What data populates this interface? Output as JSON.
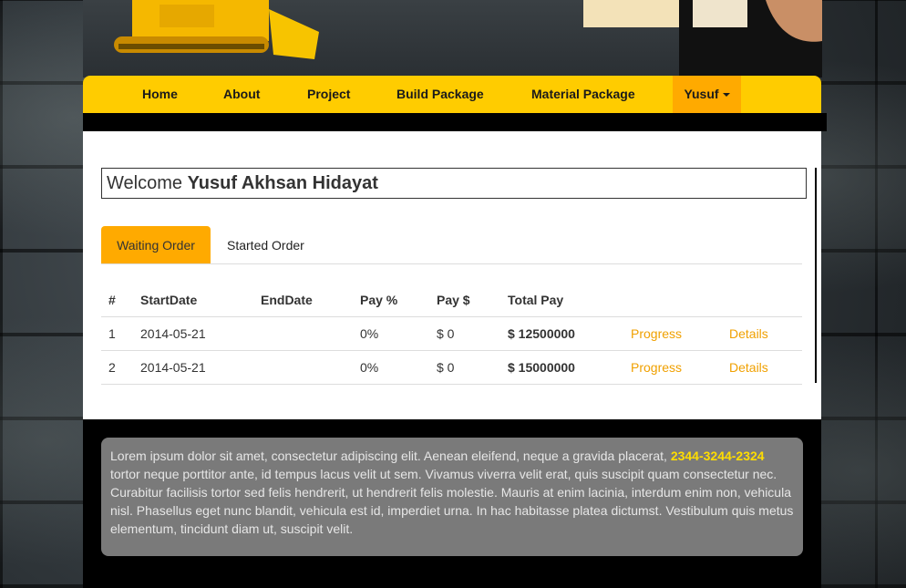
{
  "nav": {
    "items": [
      "Home",
      "About",
      "Project",
      "Build Package",
      "Material Package"
    ],
    "user_label": "Yusuf"
  },
  "welcome": {
    "prefix": "Welcome",
    "name": "Yusuf Akhsan Hidayat"
  },
  "tabs": [
    "Waiting Order",
    "Started Order"
  ],
  "table": {
    "headers": [
      "#",
      "StartDate",
      "EndDate",
      "Pay %",
      "Pay $",
      "Total Pay",
      "",
      ""
    ],
    "rows": [
      {
        "num": "1",
        "start": "2014-05-21",
        "end": "",
        "pay_pct": "0%",
        "pay_amt": "$ 0",
        "total": "$ 12500000",
        "progress": "Progress",
        "details": "Details"
      },
      {
        "num": "2",
        "start": "2014-05-21",
        "end": "",
        "pay_pct": "0%",
        "pay_amt": "$ 0",
        "total": "$ 15000000",
        "progress": "Progress",
        "details": "Details"
      }
    ]
  },
  "footer": {
    "text_before": "Lorem ipsum dolor sit amet, consectetur adipiscing elit. Aenean eleifend, neque a gravida placerat,",
    "phone": "2344-3244-2324",
    "text_after": "tortor neque porttitor ante, id tempus lacus velit ut sem. Vivamus viverra velit erat, quis suscipit quam consectetur nec. Curabitur facilisis tortor sed felis hendrerit, ut hendrerit felis molestie. Mauris at enim lacinia, interdum enim non, vehicula nisl. Phasellus eget nunc blandit, vehicula est id, imperdiet urna. In hac habitasse platea dictumst. Vestibulum quis metus elementum, tincidunt diam ut, suscipit velit."
  },
  "colors": {
    "navbar": "#ffcc00",
    "active": "#ffaa00",
    "link": "#f0a000",
    "phone": "#ffdd00"
  }
}
